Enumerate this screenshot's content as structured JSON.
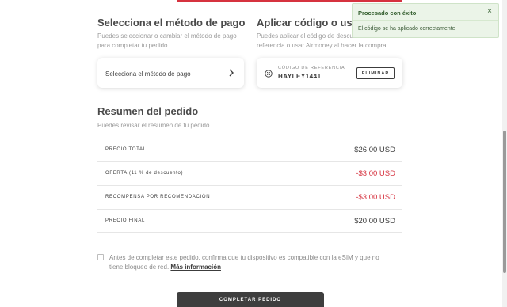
{
  "payment": {
    "title": "Selecciona el método de pago",
    "description": "Puedes seleccionar o cambiar el método de pago para completar tu pedido.",
    "select_label": "Selecciona el método de pago"
  },
  "referral": {
    "title": "Aplicar código o usar Airmoney",
    "description": "Puedes aplicar el código de descuento/de referencia o usar Airmoney al hacer la compra.",
    "caption": "CÓDIGO DE REFERENCIA",
    "code": "HAYLEY1441",
    "remove_label": "ELIMINAR"
  },
  "summary": {
    "title": "Resumen del pedido",
    "description": "Puedes revisar el resumen de tu pedido.",
    "rows": [
      {
        "label": "PRECIO TOTAL",
        "value": "$26.00 USD"
      },
      {
        "label": "OFERTA (11 % de descuento)",
        "value": "-$3.00 USD"
      },
      {
        "label": "RECOMPENSA POR RECOMENDACIÓN",
        "value": "-$3.00 USD"
      },
      {
        "label": "PRECIO FINAL",
        "value": "$20.00 USD"
      }
    ]
  },
  "consent": {
    "text": "Antes de completar este pedido, confirma que tu dispositivo es compatible con la eSIM y que no tiene bloqueo de red.",
    "link": "Más información",
    "checked": false
  },
  "complete_label": "COMPLETAR PEDIDO",
  "toast": {
    "title": "Procesado con éxito",
    "message": "El código se ha aplicado correctamente.",
    "close": "×"
  },
  "colors": {
    "accent": "#d6323f",
    "negative_value": "#d6323f",
    "toast_bg": "#ebf4e8",
    "button_dark": "#3e3e3e"
  }
}
